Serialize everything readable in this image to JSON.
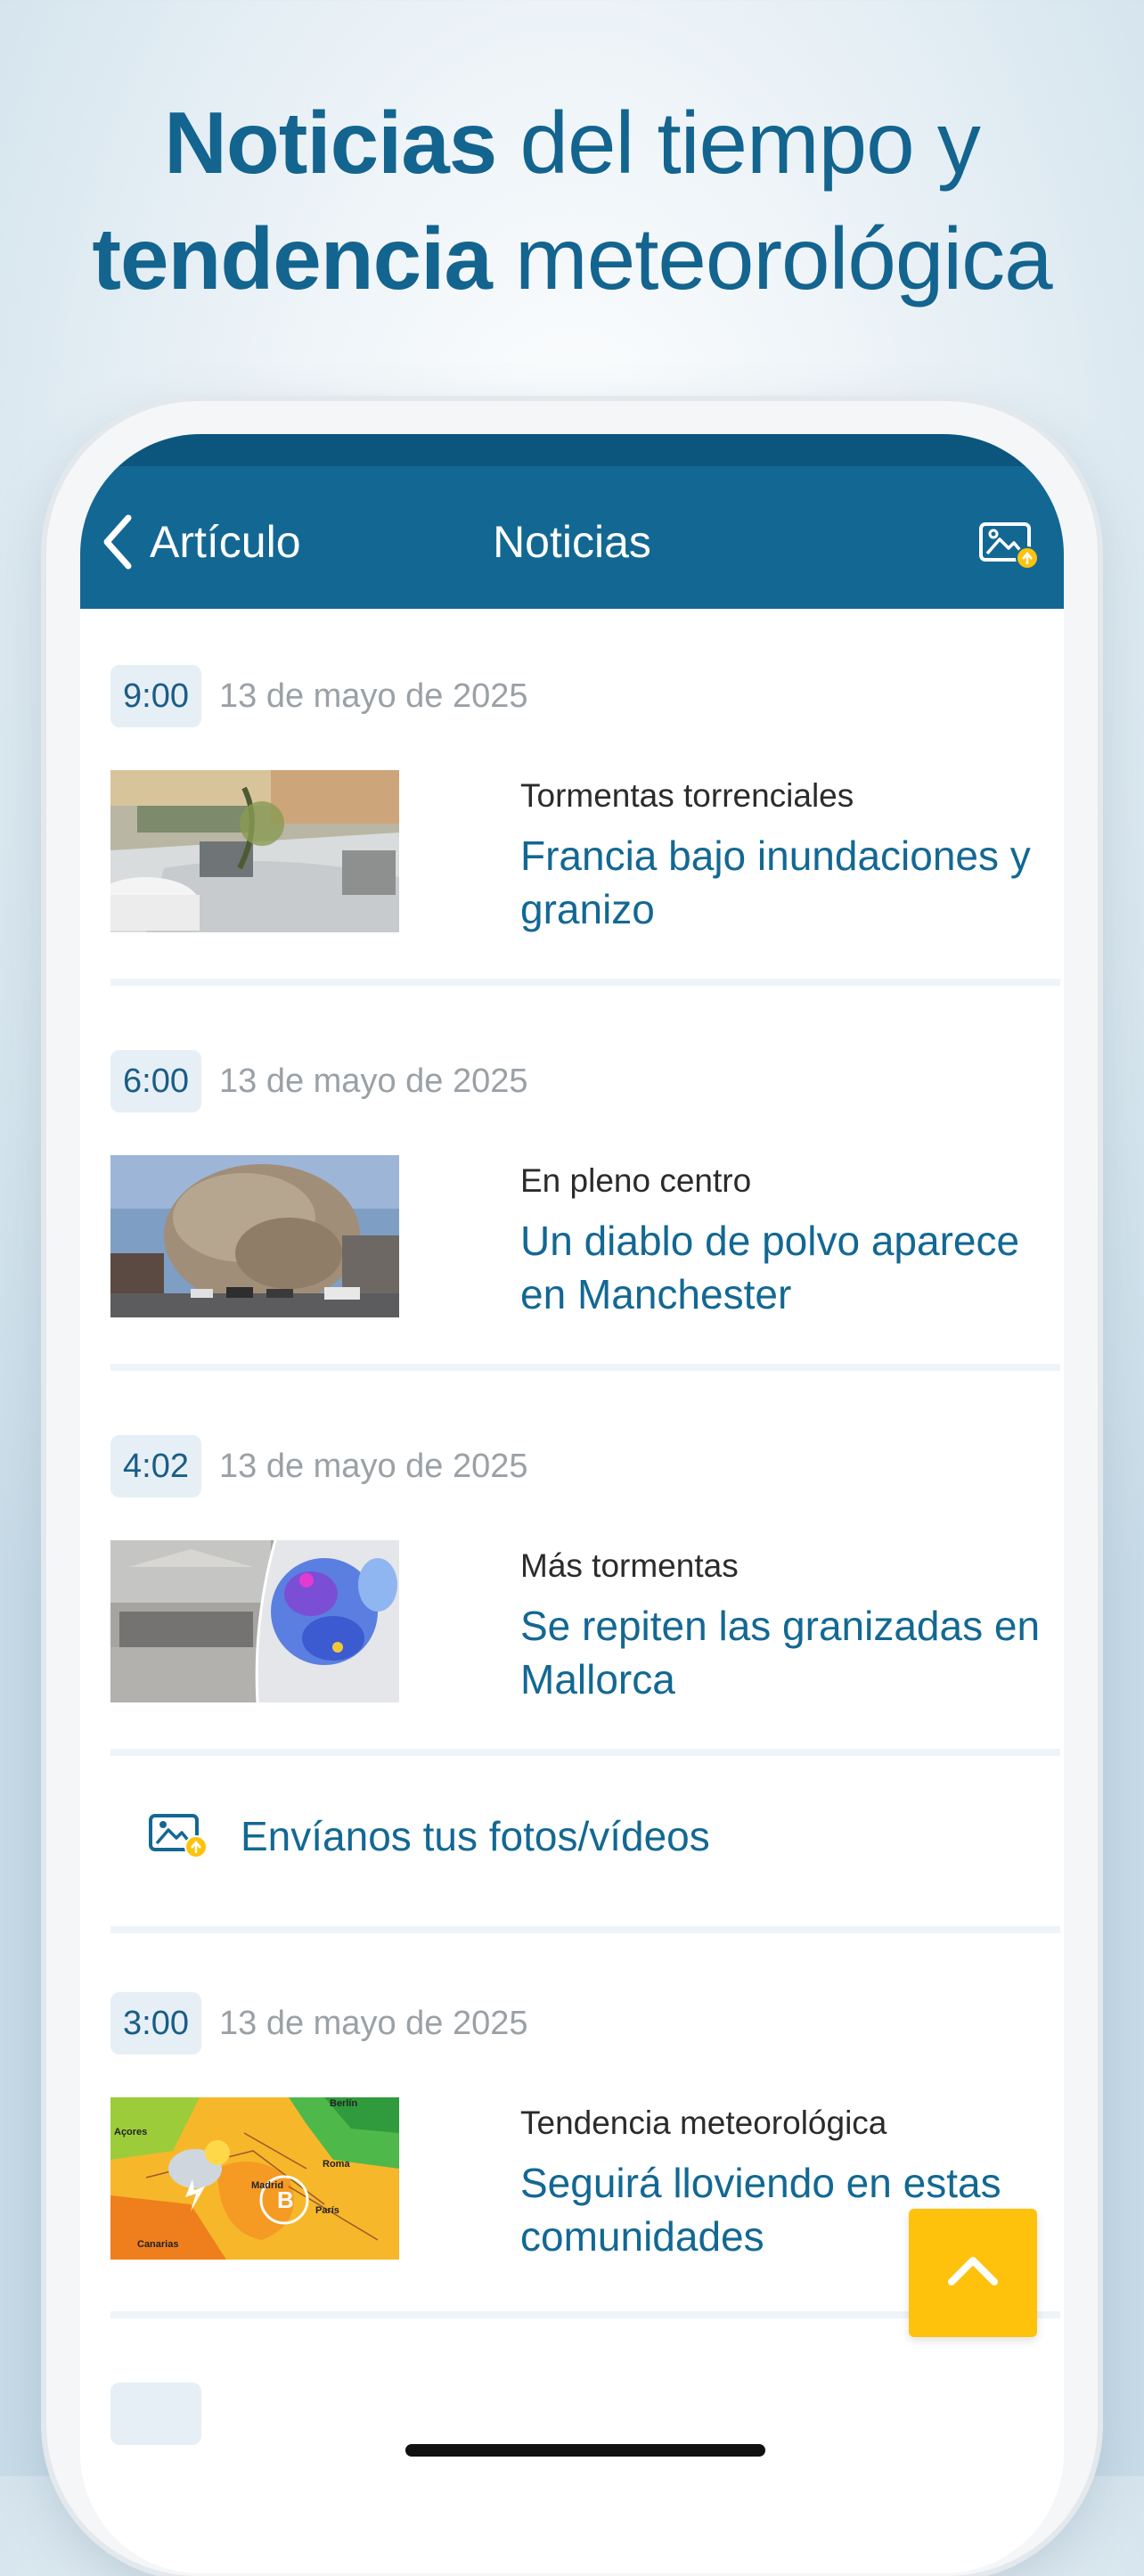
{
  "promo": {
    "line1_bold": "Noticias",
    "line1_rest": " del tiempo y",
    "line2_bold": "tendencia",
    "line2_rest": " meteorológica"
  },
  "nav": {
    "back_label": "Artículo",
    "title": "Noticias",
    "action_icon": "photo-upload-icon"
  },
  "news": [
    {
      "time": "9:00",
      "date": "13 de mayo de 2025",
      "kicker": "Tormentas torrenciales",
      "title": "Francia bajo inundaciones y granizo",
      "thumb": "flooded-street-photo"
    },
    {
      "time": "6:00",
      "date": "13 de mayo de 2025",
      "kicker": "En pleno centro",
      "title": "Un diablo de polvo aparece en Manchester",
      "thumb": "dust-devil-photo"
    },
    {
      "time": "4:02",
      "date": "13 de mayo de 2025",
      "kicker": "Más tormentas",
      "title": "Se repiten las granizadas en Mallorca",
      "thumb": "hail-radar-composite"
    },
    {
      "time": "3:00",
      "date": "13 de mayo de 2025",
      "kicker": "Tendencia meteorológica",
      "title": "Seguirá lloviendo en estas comunidades",
      "thumb": "weather-map",
      "map_labels": [
        "Açores",
        "Madrid",
        "Roma",
        "Berlín",
        "Canarias",
        "París"
      ]
    }
  ],
  "cta": {
    "label": "Envíanos tus fotos/vídeos",
    "icon": "photo-upload-icon"
  },
  "scroll_top": {
    "icon": "chevron-up-icon"
  },
  "colors": {
    "brand_blue": "#136893",
    "status_dark": "#0c567d",
    "accent_yellow": "#fec20c",
    "badge_bg": "#e6eff6"
  }
}
